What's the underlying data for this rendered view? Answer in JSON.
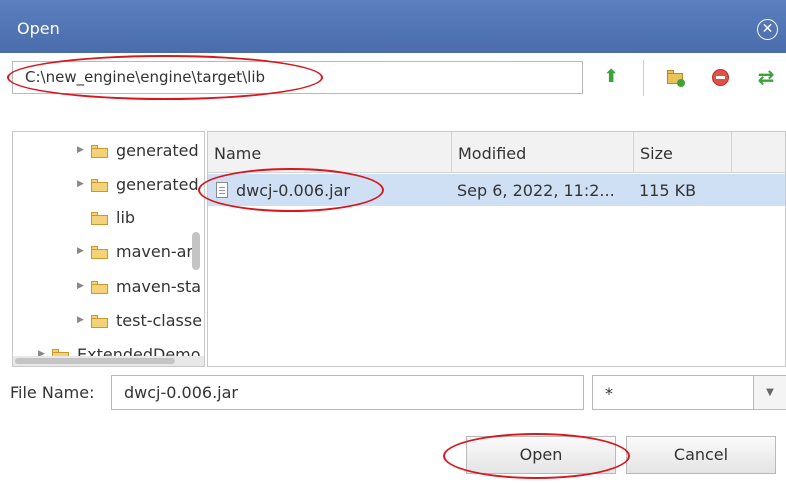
{
  "dialog": {
    "title": "Open",
    "close_glyph": "✕"
  },
  "toolbar": {
    "path": "C:\\new_engine\\engine\\target\\lib",
    "icons": [
      "up-arrow-icon",
      "new-folder-icon",
      "delete-icon",
      "refresh-icon"
    ],
    "up_glyph": "⬆",
    "refresh_glyph": "⇄"
  },
  "tree": {
    "items": [
      {
        "label": "generated",
        "expandable": true
      },
      {
        "label": "generated",
        "expandable": true
      },
      {
        "label": "lib",
        "expandable": false
      },
      {
        "label": "maven-ar",
        "expandable": true
      },
      {
        "label": "maven-sta",
        "expandable": true
      },
      {
        "label": "test-classe",
        "expandable": true
      },
      {
        "label": "ExtendedDemo",
        "expandable": true
      }
    ]
  },
  "file_list": {
    "columns": [
      "Name",
      "Modified",
      "Size"
    ],
    "rows": [
      {
        "name": "dwcj-0.006.jar",
        "modified": "Sep 6, 2022, 11:2...",
        "size": "115 KB"
      }
    ]
  },
  "footer": {
    "file_name_label": "File Name:",
    "file_name_value": "dwcj-0.006.jar",
    "filter_value": "*",
    "open_label": "Open",
    "cancel_label": "Cancel"
  },
  "colors": {
    "title_bar": "#4a6cab",
    "selected_row": "#cfe0f5",
    "annotation": "#d7161e"
  }
}
